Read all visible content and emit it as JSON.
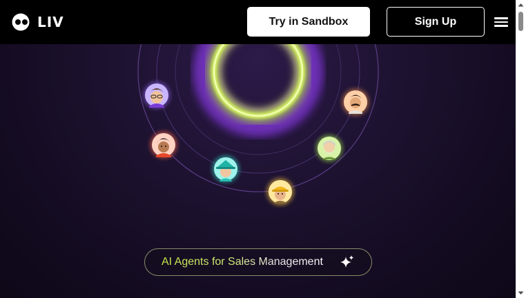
{
  "header": {
    "logo_text": "LIV",
    "sandbox_label": "Try in Sandbox",
    "signup_label": "Sign Up",
    "menu_icon": "hamburger-menu-icon"
  },
  "hero": {
    "ring_colors": {
      "outer_glow": "#8a3cd8",
      "inner_ring": "#c7ea4a"
    },
    "avatars": [
      {
        "name": "avatar-purple-glasses",
        "glow": "#9c6bff"
      },
      {
        "name": "avatar-orange-hair",
        "glow": "#ff6a4a"
      },
      {
        "name": "avatar-teal-hat",
        "glow": "#2ed8c8"
      },
      {
        "name": "avatar-yellow-cap",
        "glow": "#ffc93a"
      },
      {
        "name": "avatar-green-beard",
        "glow": "#9be04a"
      },
      {
        "name": "avatar-mustache",
        "glow": "#ff9a4a"
      }
    ]
  },
  "tagline": {
    "text": "AI Agents for Sales Management",
    "icon": "sparkle-icon"
  },
  "colors": {
    "accent": "#c7ea4a",
    "background": "#1d1230",
    "header_bg": "#000000"
  }
}
